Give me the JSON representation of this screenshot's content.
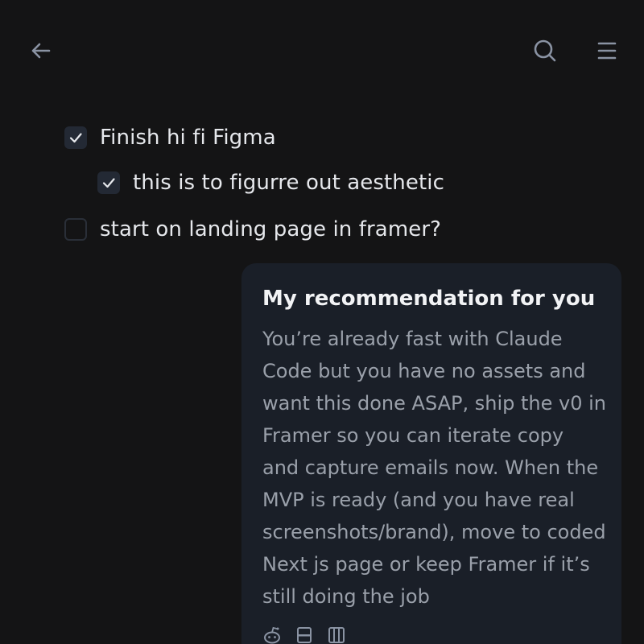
{
  "tasks": [
    {
      "label": "Finish hi fi Figma",
      "checked": true
    },
    {
      "label": "this is to figurre out aesthetic",
      "checked": true
    },
    {
      "label": "start on landing page in framer?",
      "checked": false
    }
  ],
  "recommendation": {
    "title": "My recommendation for you",
    "lines": [
      "You’re already fast with Claude",
      "Code but you have no assets and",
      "want this done ASAP, ship the v0 in",
      "Framer so you can iterate copy",
      "and capture emails now. When the",
      "MVP is ready (and you have real",
      "screenshots/brand), move to coded",
      "Next js page or keep Framer if it’s",
      "still doing the job"
    ]
  },
  "icons": {
    "back": "back-arrow-icon",
    "search": "search-icon",
    "menu": "menu-icon",
    "card_actions": [
      "reddit-icon",
      "card-icon",
      "columns-icon"
    ]
  },
  "colors": {
    "background": "#141415",
    "card": "#1a1f28",
    "checkbox": "#232934",
    "icon": "#8a93a3"
  }
}
